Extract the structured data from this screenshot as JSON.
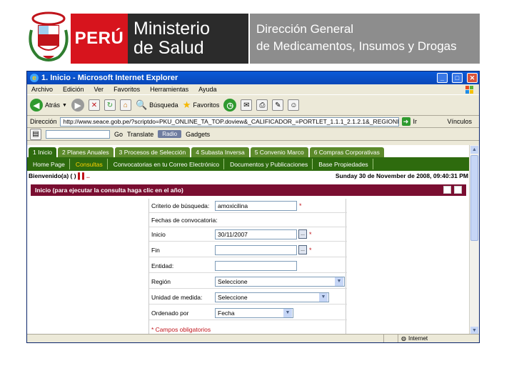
{
  "header": {
    "peru": "PERÚ",
    "ministry_line1": "Ministerio",
    "ministry_line2": "de Salud",
    "directorate_line1": "Dirección General",
    "directorate_line2": "de Medicamentos, Insumos y Drogas"
  },
  "browser": {
    "title": "1. Inicio - Microsoft Internet Explorer",
    "menu": [
      "Archivo",
      "Edición",
      "Ver",
      "Favoritos",
      "Herramientas",
      "Ayuda"
    ],
    "toolbar": {
      "back": "Atrás",
      "search": "Búsqueda",
      "favorites": "Favoritos"
    },
    "address_label": "Dirección",
    "address_url": "http://www.seace.gob.pe/?scriptdo=PKU_ONLINE_TA_TOP.doview&_CALIFICADOR_=PORTLET_1.1.1_2.1.2.1&_REGIONID_=",
    "go_label": "Ir",
    "links_label": "Vínculos",
    "go2": "Go",
    "translate": "Translate",
    "radio": "Radio",
    "gadgets": "Gadgets",
    "status_zone": "Internet"
  },
  "page": {
    "tabs": [
      "1 Inicio",
      "2 Planes Anuales",
      "3 Procesos de Selección",
      "4 Subasta Inversa",
      "5 Convenio Marco",
      "6 Compras Corporativas"
    ],
    "subtabs": [
      "Home Page",
      "Consultas",
      "Convocatorias en tu Correo Electrónico",
      "Documentos y Publicaciones",
      "Base Propiedades"
    ],
    "welcome": "Bienvenido(a) ( )",
    "welcome_mark": "▌▌..",
    "datetime": "Sunday 30 de November de 2008, 09:40:31 PM",
    "panel_title": "Inicio (para ejecutar la consulta haga clic en el año)",
    "form": {
      "criterio_label": "Criterio de búsqueda:",
      "criterio_value": "amoxicilina",
      "fechas_label": "Fechas de convocatoria:",
      "inicio_label": "Inicio",
      "inicio_value": "30/11/2007",
      "fin_label": "Fin",
      "fin_value": "",
      "entidad_label": "Entidad:",
      "entidad_value": "",
      "region_label": "Región",
      "region_value": "Seleccione",
      "unidad_label": "Unidad de medida:",
      "unidad_value": "Seleccione",
      "orden_label": "Ordenado por",
      "orden_value": "Fecha",
      "calendar_btn": "...",
      "required": "*",
      "note": "* Campos obligatorios"
    }
  }
}
